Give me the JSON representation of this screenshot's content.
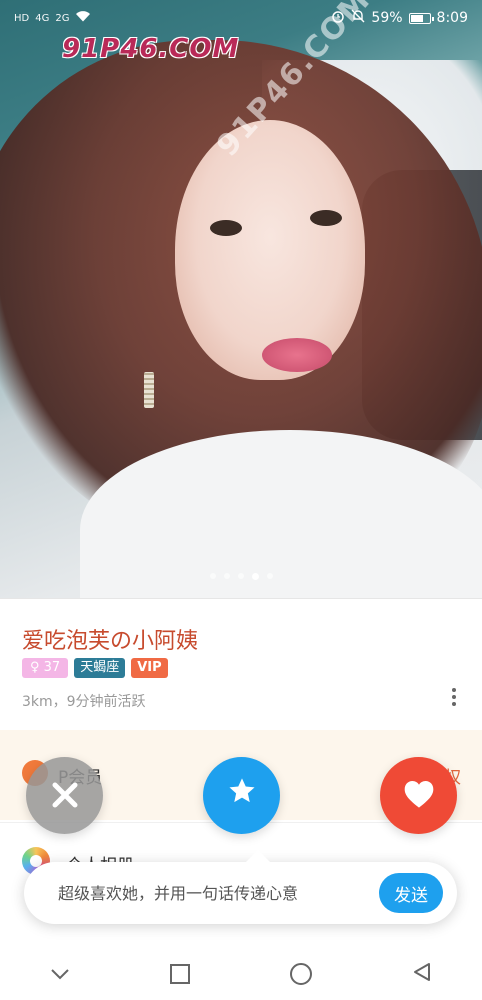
{
  "status_bar": {
    "carrier_left": "HD",
    "signal_1": "4G",
    "signal_2": "2G",
    "battery_percent": "59%",
    "time": "8:09"
  },
  "photo": {
    "watermark": "91P46.COM",
    "watermark_diagonal": "91P46.COM",
    "page_count": 5,
    "active_page_index": 3
  },
  "profile": {
    "name": "爱吃泡芙の小阿姨",
    "age_badge": "♀ 37",
    "zodiac_badge": "天蝎座",
    "vip_badge": "VIP",
    "meta": "3km，9分钟前活跃"
  },
  "rows": {
    "vip_label": "P会员",
    "vip_right": "权",
    "album_label": "个人相册"
  },
  "actions": {
    "dislike_icon": "close-icon",
    "super_icon": "star-icon",
    "like_icon": "heart-icon"
  },
  "message": {
    "placeholder": "超级喜欢她，并用一句话传递心意",
    "send_label": "发送"
  },
  "colors": {
    "name": "#c74b2e",
    "super_like": "#1ea0ee",
    "like": "#ef4a36",
    "vip_badge": "#f06a44",
    "zodiac_badge": "#2d7c97"
  }
}
